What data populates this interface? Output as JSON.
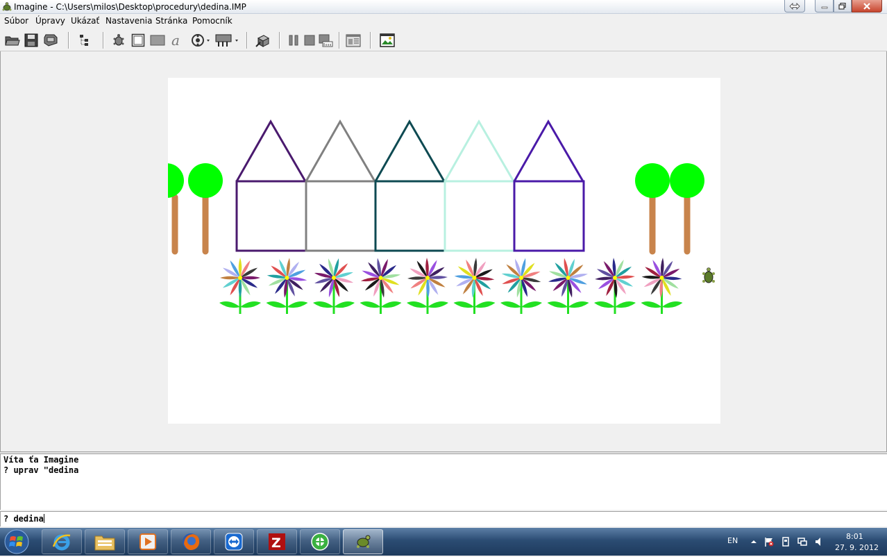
{
  "window": {
    "title": "Imagine - C:\\Users\\milos\\Desktop\\procedury\\dedina.IMP",
    "buttons": [
      "restore-arrows-icon",
      "minimize-icon",
      "maximize-icon",
      "close-icon"
    ]
  },
  "menu": {
    "items": [
      "Súbor",
      "Úpravy",
      "Ukázať",
      "Nastavenia",
      "Stránka",
      "Pomocník"
    ]
  },
  "toolbar": {
    "icons": [
      "open-folder-icon",
      "save-disk-icon",
      "print-icon",
      "project-tree-icon",
      "turtle-icon",
      "frame-icon",
      "rectangle-icon",
      "text-a-icon",
      "media-player-icon",
      "button-icon",
      "settings-cube-icon",
      "pause-icon",
      "stop-icon",
      "run-icon",
      "page-editor-icon",
      "picture-icon"
    ]
  },
  "scene": {
    "houses": [
      {
        "color": "#4a1a6e"
      },
      {
        "color": "#808080"
      },
      {
        "color": "#0e4a52"
      },
      {
        "color": "#b8f0e0"
      },
      {
        "color": "#4a1aa8"
      }
    ],
    "tree_crown_color": "#00ff00",
    "tree_trunk_color": "#c8844c",
    "stem_color": "#22e022",
    "flower_center_color": "#ffff00",
    "flower_count": 10
  },
  "console": {
    "lines": [
      "Víta ťa Imagine",
      "? uprav \"dedina"
    ]
  },
  "command_line": {
    "value": "? dedina"
  },
  "taskbar": {
    "apps": [
      "internet-explorer-icon",
      "file-explorer-icon",
      "media-player-icon",
      "firefox-icon",
      "teamviewer-icon",
      "filezilla-icon",
      "greenshot-icon",
      "imagine-turtle-icon"
    ],
    "language": "EN",
    "time": "8:01",
    "date": "27. 9. 2012"
  }
}
